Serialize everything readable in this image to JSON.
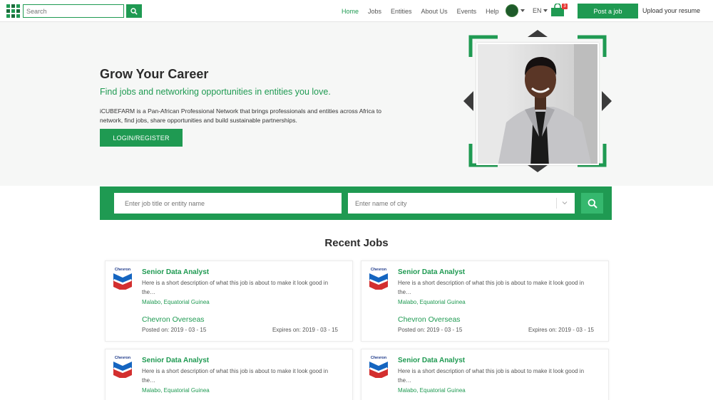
{
  "nav": {
    "search_placeholder": "Search",
    "links": [
      "Home",
      "Jobs",
      "Entities",
      "About Us",
      "Events",
      "Help"
    ],
    "active_link": "Home",
    "language": "EN",
    "cart_count": "3",
    "post_job_label": "Post a job",
    "upload_resume_label": "Upload your resume"
  },
  "hero": {
    "title": "Grow Your Career",
    "subtitle": "Find jobs and networking opportunities in entities you love.",
    "description": "iCUBEFARM is a Pan-African Professional Network that brings professionals and entities across Africa to network, find jobs, share opportunities and build sustainable partnerships.",
    "login_label": "LOGIN/REGISTER"
  },
  "job_search": {
    "job_placeholder": "Enter job title or entity name",
    "city_placeholder": "Enter name of city"
  },
  "recent_jobs": {
    "title": "Recent Jobs",
    "company_logo_text": "Chevron",
    "items": [
      {
        "title": "Senior Data Analyst",
        "description": "Here is a short description of what this job is about to make it look good in the…",
        "location": "Malabo, Equatorial Guinea",
        "company": "Chevron Overseas",
        "posted": "Posted on: 2019 - 03 - 15",
        "expires": "Expires on: 2019 - 03 - 15"
      },
      {
        "title": "Senior Data Analyst",
        "description": "Here is a short description of what this job is about to make it look good in the…",
        "location": "Malabo, Equatorial Guinea",
        "company": "Chevron Overseas",
        "posted": "Posted on: 2019 - 03 - 15",
        "expires": "Expires on: 2019 - 03 - 15"
      },
      {
        "title": "Senior Data Analyst",
        "description": "Here is a short description of what this job is about to make it look good in the…",
        "location": "Malabo, Equatorial Guinea",
        "company": "",
        "posted": "",
        "expires": ""
      },
      {
        "title": "Senior Data Analyst",
        "description": "Here is a short description of what this job is about to make it look good in the…",
        "location": "Malabo, Equatorial Guinea",
        "company": "",
        "posted": "",
        "expires": ""
      }
    ]
  },
  "colors": {
    "brand_green": "#1f9a52",
    "search_button": "#35b86e",
    "badge_red": "#e53935"
  },
  "icons": [
    "logo-icon",
    "search-icon",
    "avatar",
    "chevron-down-icon",
    "shopping-bag-icon",
    "chevron-logo"
  ]
}
